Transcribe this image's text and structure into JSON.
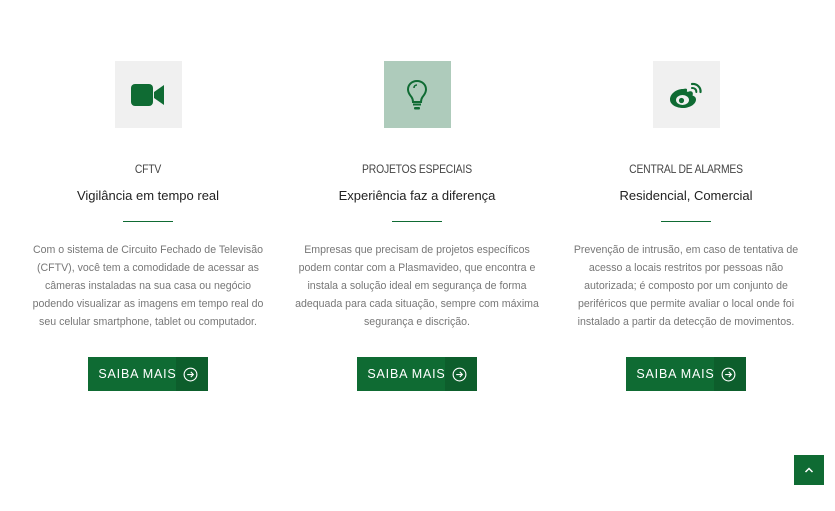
{
  "services": [
    {
      "icon": "video-camera-icon",
      "title": "CFTV",
      "subtitle": "Vigilância em tempo real",
      "description": "Com o sistema de Circuito Fechado de Televisão (CFTV), você tem a comodidade de acessar as câmeras instaladas na sua casa ou negócio podendo visualizar as imagens em tempo real do seu celular smartphone, tablet ou computador.",
      "button_label": "SAIBA MAIS"
    },
    {
      "icon": "lightbulb-icon",
      "title": "PROJETOS ESPECIAIS",
      "subtitle": "Experiência faz a diferença",
      "description": "Empresas que precisam de projetos específicos podem contar com a Plasmavideo, que encontra e instala a solução ideal em segurança de forma adequada para cada situação, sempre com máxima segurança e discrição.",
      "button_label": "SAIBA MAIS"
    },
    {
      "icon": "weibo-icon",
      "title": "CENTRAL DE ALARMES",
      "subtitle": "Residencial, Comercial",
      "description": "Prevenção de intrusão, em caso de tentativa de acesso a locais restritos por pessoas não autorizada; é composto por um conjunto de periféricos que permite avaliar o local onde foi instalado a partir da detecção de movimentos.",
      "button_label": "SAIBA MAIS"
    }
  ],
  "back_to_top": {
    "icon": "chevron-up-icon"
  },
  "colors": {
    "accent": "#0f6b33",
    "icon_bg": "#f0f0f0",
    "icon_bg_active": "#aecbbb"
  }
}
